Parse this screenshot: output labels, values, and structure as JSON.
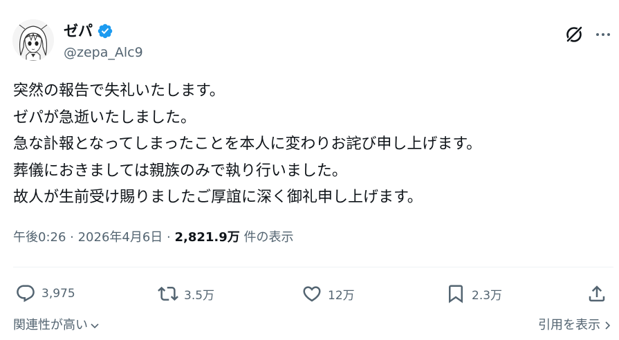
{
  "author": {
    "display_name": "ゼパ",
    "handle": "@zepa_Alc9",
    "verified": true
  },
  "tweet": {
    "lines": [
      "突然の報告で失礼いたします。",
      "ゼパが急逝いたしました。",
      "急な訃報となってしまったことを本人に変わりお詫び申し上げます。",
      "葬儀におきましては親族のみで執り行いました。",
      "故人が生前受け賜りましたご厚誼に深く御礼申し上げます。"
    ]
  },
  "meta": {
    "time": "午後0:26",
    "separator1": " · ",
    "date": "2026年4月6日",
    "separator2": " · ",
    "views": "2,821.9万",
    "views_label": " 件の表示"
  },
  "actions": {
    "reply": "3,975",
    "retweet": "3.5万",
    "like": "12万",
    "bookmark": "2.3万"
  },
  "footer": {
    "sort": "関連性が高い",
    "quotes": "引用を表示"
  },
  "colors": {
    "text": "#0f1419",
    "secondary": "#536471",
    "verified": "#1d9bf0",
    "divider": "#eff3f4"
  },
  "icons": [
    "verified-badge-icon",
    "grok-icon",
    "more-icon",
    "reply-icon",
    "retweet-icon",
    "like-icon",
    "bookmark-icon",
    "share-icon",
    "chevron-down-icon",
    "chevron-right-icon"
  ]
}
